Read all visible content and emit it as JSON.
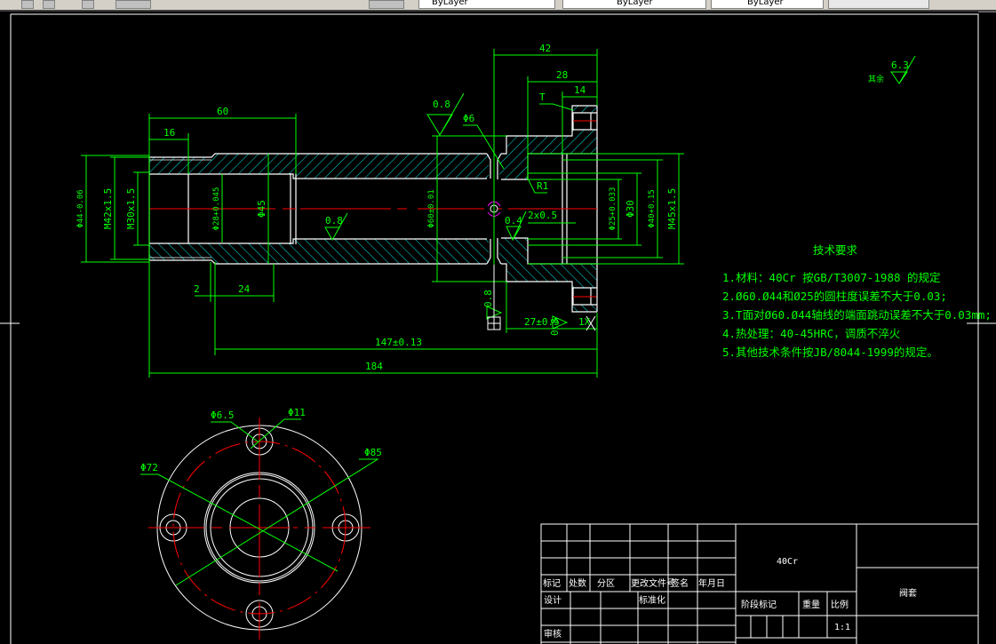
{
  "toolbar": {
    "layer_dropdowns": [
      "ByLayer",
      "ByLayer",
      "ByLayer"
    ]
  },
  "colors": {
    "background": "#000000",
    "dimension": "#00ff00",
    "outline": "#ffffff",
    "hatch": "#00ffff",
    "centerline": "#ff0000",
    "marker": "#ff00ff"
  },
  "front_view": {
    "dims": {
      "d60": "60",
      "d16": "16",
      "d42": "42",
      "d28": "28",
      "d14": "14",
      "t": "T",
      "phi6": "Φ6",
      "r1": "R1",
      "chamfer": "2x0.5",
      "ra04": "0.4",
      "ra08_a": "0.8",
      "ra08_b": "0.8",
      "ra08_c": "0.8",
      "ra08_d": "0.8",
      "phi44": "Φ44-0.06",
      "m42": "M42x1.5",
      "m30": "M30x1.5",
      "phi28": "Φ28+0.045",
      "phi45": "Φ45",
      "phi60": "Φ60±0.01",
      "phi25": "Φ25+0.033",
      "phi30": "Φ30",
      "phi40": "Φ40+0.15",
      "m45": "M45x1.5",
      "d2": "2",
      "d24": "24",
      "d147": "147±0.13",
      "d184": "184",
      "d27": "27±0.5",
      "x1": "1X"
    }
  },
  "side_view": {
    "dims": {
      "phi65": "Φ6.5",
      "phi11": "Φ11",
      "phi72": "Φ72",
      "phi85": "Φ85"
    }
  },
  "roughness_note": {
    "value": "6.3",
    "label": "其余"
  },
  "tech_requirements": {
    "title": "技术要求",
    "items": [
      "1.材料：40Cr 按GB/T3007-1988 的规定",
      "2.Ø60.Ø44和Ø25的圆柱度误差不大于0.03;",
      "3.T面对Ø60.Ø44轴线的端面跳动误差不大于0.03mm;",
      "4.热处理：40-45HRC，调质不淬火",
      "5.其他技术条件按JB/8044-1999的规定。"
    ]
  },
  "title_block": {
    "material": "40Cr",
    "part_name": "阀套",
    "scale": "1:1",
    "labels": {
      "mark": "标记",
      "count": "处数",
      "zone": "分区",
      "change_doc": "更改文件号",
      "sign": "签名",
      "date": "年月日",
      "design": "设计",
      "standard": "标准化",
      "review": "审核",
      "stage": "阶段标记",
      "weight": "重量",
      "ratio": "比例"
    }
  }
}
